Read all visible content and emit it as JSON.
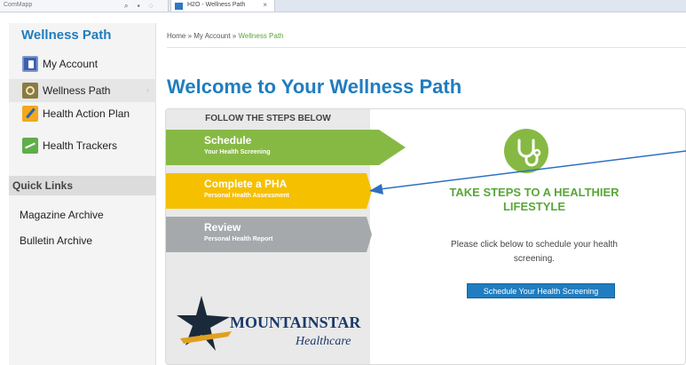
{
  "browser": {
    "address_fragment": "ComMapp",
    "tab_title": "H2O - Wellness Path",
    "tab_close": "×"
  },
  "sidebar": {
    "title": "Wellness Path",
    "items": [
      {
        "label": "My Account",
        "icon": "account-book-icon"
      },
      {
        "label": "Wellness Path",
        "icon": "wellness-compass-icon"
      },
      {
        "label": "Health Action Plan",
        "icon": "action-plan-icon"
      },
      {
        "label": "Health Trackers",
        "icon": "trackers-chart-icon"
      }
    ],
    "active_chevron": "›",
    "quick_links_heading": "Quick Links",
    "quick_links": [
      "Magazine Archive",
      "Bulletin Archive"
    ]
  },
  "breadcrumb": {
    "home": "Home",
    "sep1": " » ",
    "account": "My Account",
    "sep2": " » ",
    "current": "Wellness Path"
  },
  "page_title": "Welcome to Your Wellness Path",
  "steps": {
    "heading": "FOLLOW THE STEPS BELOW",
    "items": [
      {
        "title": "Schedule",
        "subtitle": "Your Health Screening",
        "color": "#86b944"
      },
      {
        "title": "Complete a PHA",
        "subtitle": "Personal Health Assessment",
        "color": "#f5c000"
      },
      {
        "title": "Review",
        "subtitle": "Personal Health Report",
        "color": "#a5a9ab"
      }
    ]
  },
  "logo": {
    "name": "MOUNTAINSTAR",
    "sub": "Healthcare"
  },
  "cta": {
    "icon": "stethoscope-icon",
    "heading_line1": "TAKE STEPS TO A HEALTHIER",
    "heading_line2": "LIFESTYLE",
    "text_line1": "Please click below to schedule your health",
    "text_line2": "screening.",
    "button": "Schedule Your Health Screening"
  },
  "colors": {
    "brand_blue": "#1f7dc0",
    "brand_green": "#5aa639",
    "annotation_arrow": "#2f6fc0"
  }
}
